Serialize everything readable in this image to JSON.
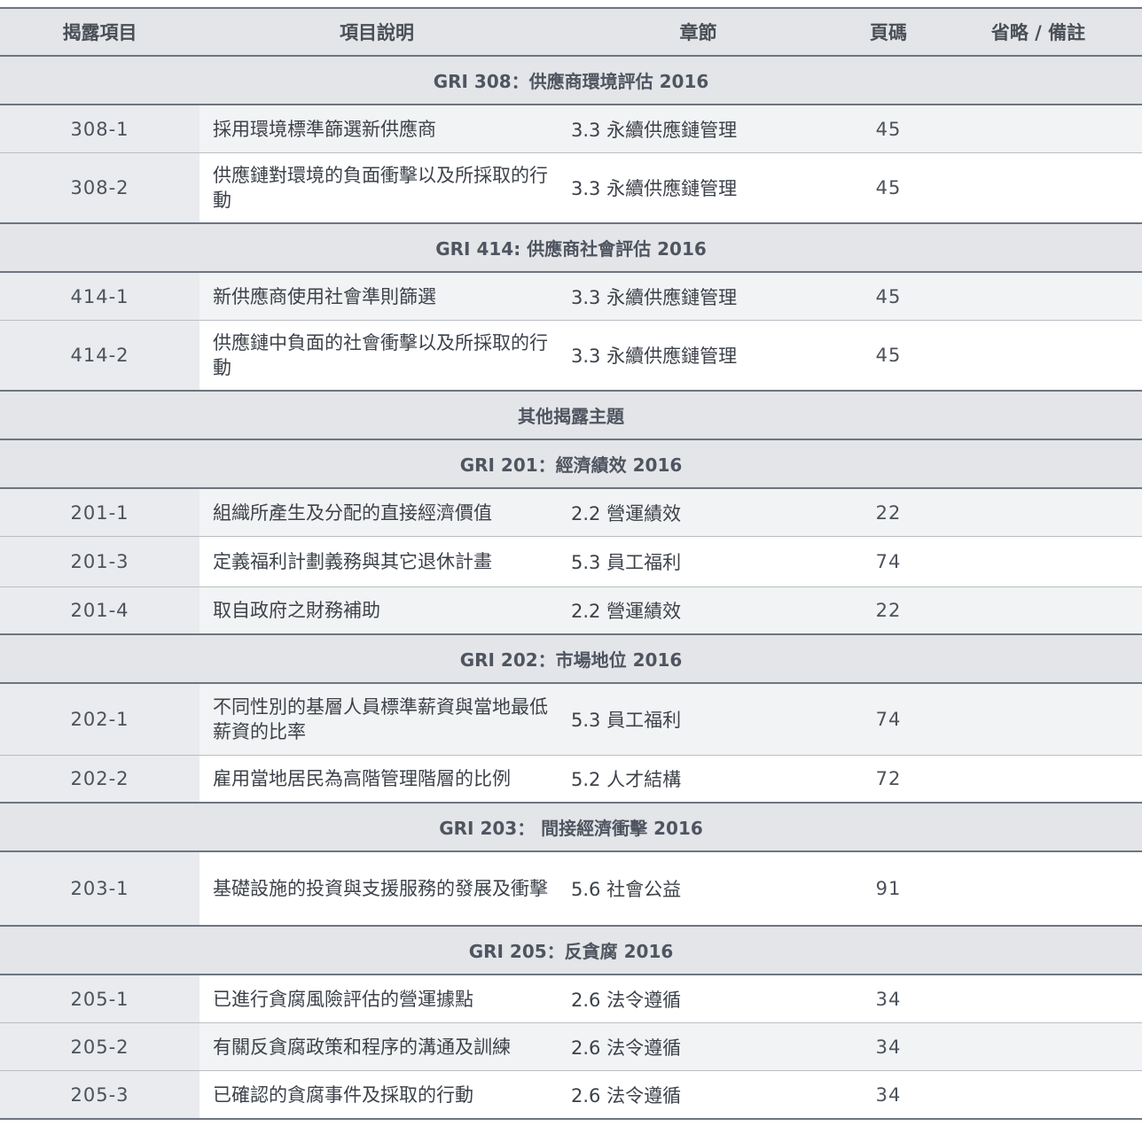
{
  "header": {
    "code": "揭露項目",
    "description": "項目說明",
    "chapter": "章節",
    "page": "頁碼",
    "note": "省略 / 備註"
  },
  "sections": [
    {
      "title": "GRI 308：供應商環境評估 2016",
      "rows": [
        {
          "code": "308-1",
          "description": "採用環境標準篩選新供應商",
          "chapter": "3.3 永續供應鏈管理",
          "page": "45",
          "note": ""
        },
        {
          "code": "308-2",
          "description": "供應鏈對環境的負面衝擊以及所採取的行動",
          "chapter": "3.3 永續供應鏈管理",
          "page": "45",
          "note": ""
        }
      ]
    },
    {
      "title": "GRI 414: 供應商社會評估 2016",
      "rows": [
        {
          "code": "414-1",
          "description": "新供應商使用社會準則篩選",
          "chapter": "3.3 永續供應鏈管理",
          "page": "45",
          "note": ""
        },
        {
          "code": "414-2",
          "description": "供應鏈中負面的社會衝擊以及所採取的行動",
          "chapter": "3.3 永續供應鏈管理",
          "page": "45",
          "note": ""
        }
      ]
    },
    {
      "title": "其他揭露主題",
      "rows": []
    },
    {
      "title": "GRI 201：經濟績效 2016",
      "rows": [
        {
          "code": "201-1",
          "description": "組織所產生及分配的直接經濟價值",
          "chapter": "2.2 營運績效",
          "page": "22",
          "note": ""
        },
        {
          "code": "201-3",
          "description": "定義福利計劃義務與其它退休計畫",
          "chapter": "5.3 員工福利",
          "page": "74",
          "note": ""
        },
        {
          "code": "201-4",
          "description": "取自政府之財務補助",
          "chapter": "2.2 營運績效",
          "page": "22",
          "note": ""
        }
      ]
    },
    {
      "title": "GRI 202：市場地位 2016",
      "rows": [
        {
          "code": "202-1",
          "description": "不同性別的基層人員標準薪資與當地最低薪資的比率",
          "chapter": "5.3 員工福利",
          "page": "74",
          "note": ""
        },
        {
          "code": "202-2",
          "description": "雇用當地居民為高階管理階層的比例",
          "chapter": "5.2 人才結構",
          "page": "72",
          "note": ""
        }
      ]
    },
    {
      "title": "GRI 203： 間接經濟衝擊 2016",
      "rows": [
        {
          "code": "203-1",
          "description": "基礎設施的投資與支援服務的發展及衝擊",
          "chapter": "5.6 社會公益",
          "page": "91",
          "note": ""
        }
      ]
    },
    {
      "title": "GRI 205：反貪腐 2016",
      "rows": [
        {
          "code": "205-1",
          "description": "已進行貪腐風險評估的營運據點",
          "chapter": "2.6 法令遵循",
          "page": "34",
          "note": ""
        },
        {
          "code": "205-2",
          "description": "有關反貪腐政策和程序的溝通及訓練",
          "chapter": "2.6 法令遵循",
          "page": "34",
          "note": ""
        },
        {
          "code": "205-3",
          "description": "已確認的貪腐事件及採取的行動",
          "chapter": "2.6 法令遵循",
          "page": "34",
          "note": ""
        }
      ]
    }
  ]
}
